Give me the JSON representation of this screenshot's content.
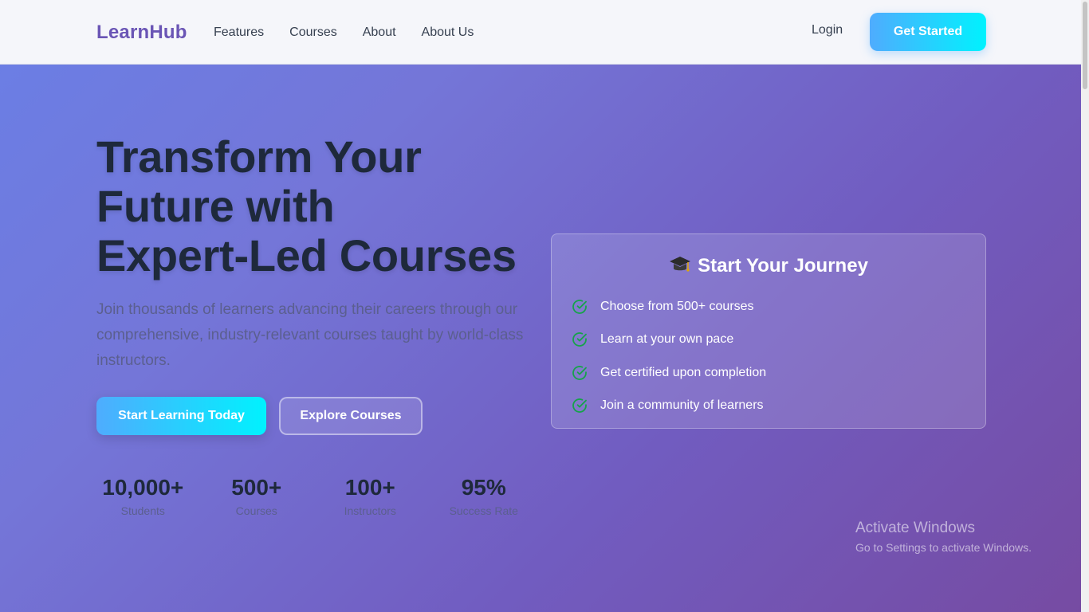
{
  "navbar": {
    "logo": "LearnHub",
    "links": [
      "Features",
      "Courses",
      "About",
      "About Us"
    ],
    "login": "Login",
    "cta": "Get Started"
  },
  "hero": {
    "title_lines": [
      "Transform Your",
      "Future with",
      "Expert-Led Courses"
    ],
    "subtitle": "Join thousands of learners advancing their careers through our comprehensive, industry-relevant courses taught by world-class instructors.",
    "primary_button": "Start Learning Today",
    "secondary_button": "Explore Courses"
  },
  "stats": [
    {
      "value": "10,000+",
      "label": "Students"
    },
    {
      "value": "500+",
      "label": "Courses"
    },
    {
      "value": "100+",
      "label": "Instructors"
    },
    {
      "value": "95%",
      "label": "Success Rate"
    }
  ],
  "card": {
    "icon": "graduation-cap-icon",
    "title": "Start Your Journey",
    "items": [
      "Choose from 500+ courses",
      "Learn at your own pace",
      "Get certified upon completion",
      "Join a community of learners"
    ]
  },
  "watermark": {
    "title": "Activate Windows",
    "subtitle": "Go to Settings to activate Windows."
  },
  "colors": {
    "brand": "#6a55b5",
    "accent_gradient_start": "#4facfe",
    "accent_gradient_end": "#00f2fe",
    "check": "#16a34a"
  }
}
